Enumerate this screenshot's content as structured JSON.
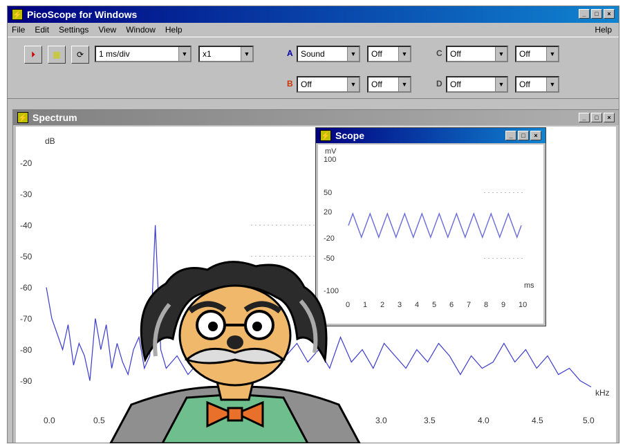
{
  "app": {
    "title": "PicoScope for Windows",
    "help_label": "Help",
    "menu": [
      "File",
      "Edit",
      "Settings",
      "View",
      "Window",
      "Help"
    ]
  },
  "toolbar": {
    "timebase": "1 ms/div",
    "multiplier": "x1",
    "channel_a_label": "A",
    "channel_a_coupling": "Sound",
    "channel_a_range": "Off",
    "channel_b_label": "B",
    "channel_b_coupling": "Off",
    "channel_b_range": "Off",
    "channel_c_label": "C",
    "channel_c_coupling": "Off",
    "channel_c_range": "Off",
    "channel_d_label": "D",
    "channel_d_coupling": "Off",
    "channel_d_range": "Off"
  },
  "spectrum": {
    "title": "Spectrum",
    "y_unit": "dB",
    "x_unit": "kHz",
    "y_ticks": [
      "-20",
      "-30",
      "-40",
      "-50",
      "-60",
      "-70",
      "-80",
      "-90"
    ],
    "x_ticks": [
      "0.0",
      "0.5",
      "3.0",
      "3.5",
      "4.0",
      "4.5",
      "5.0"
    ]
  },
  "scope": {
    "title": "Scope",
    "y_unit": "mV",
    "x_unit": "ms",
    "y_ticks": [
      "100",
      "50",
      "20",
      "-20",
      "-50",
      "-100"
    ],
    "x_ticks": [
      "0",
      "1",
      "2",
      "3",
      "4",
      "5",
      "6",
      "7",
      "8",
      "9",
      "10"
    ]
  },
  "chart_data": [
    {
      "type": "line",
      "title": "",
      "xlabel": "kHz",
      "ylabel": "dB",
      "xlim": [
        0.0,
        5.0
      ],
      "ylim": [
        -95,
        -15
      ],
      "series": [
        {
          "x": [
            0.0,
            0.05,
            0.1,
            0.15,
            0.2,
            0.25,
            0.3,
            0.35,
            0.4,
            0.45,
            0.5,
            0.55,
            0.6,
            0.65,
            0.7,
            0.75,
            0.8,
            0.85,
            0.9,
            0.95,
            1.0,
            1.05,
            1.1,
            1.2,
            1.3,
            1.4,
            1.5,
            1.6,
            1.7,
            1.8,
            1.9,
            2.0,
            2.1,
            2.2,
            2.3,
            2.4,
            2.5,
            2.6,
            2.7,
            2.8,
            2.9,
            3.0,
            3.1,
            3.2,
            3.3,
            3.4,
            3.5,
            3.6,
            3.7,
            3.8,
            3.9,
            4.0,
            4.1,
            4.2,
            4.3,
            4.4,
            4.5,
            4.6,
            4.7,
            4.8,
            4.9,
            5.0
          ],
          "values": [
            -60,
            -70,
            -75,
            -80,
            -72,
            -85,
            -78,
            -82,
            -90,
            -70,
            -80,
            -72,
            -86,
            -78,
            -84,
            -88,
            -80,
            -76,
            -86,
            -82,
            -40,
            -80,
            -86,
            -82,
            -88,
            -84,
            -80,
            -86,
            -82,
            -88,
            -84,
            -80,
            -86,
            -82,
            -78,
            -84,
            -80,
            -86,
            -76,
            -84,
            -80,
            -86,
            -78,
            -82,
            -86,
            -80,
            -84,
            -78,
            -82,
            -88,
            -82,
            -86,
            -84,
            -78,
            -84,
            -80,
            -86,
            -82,
            -88,
            -86,
            -90,
            -92
          ]
        }
      ]
    },
    {
      "type": "line",
      "title": "",
      "xlabel": "ms",
      "ylabel": "mV",
      "xlim": [
        0,
        10
      ],
      "ylim": [
        -100,
        100
      ],
      "series": [
        {
          "x": [
            0,
            0.25,
            0.5,
            0.75,
            1,
            1.25,
            1.5,
            1.75,
            2,
            2.25,
            2.5,
            2.75,
            3,
            3.25,
            3.5,
            3.75,
            4,
            4.25,
            4.5,
            4.75,
            5,
            5.25,
            5.5,
            5.75,
            6,
            6.25,
            6.5,
            6.75,
            7,
            7.25,
            7.5,
            7.75,
            8,
            8.25,
            8.5,
            8.75,
            9,
            9.25,
            9.5,
            9.75,
            10
          ],
          "values": [
            0,
            18,
            0,
            -18,
            0,
            18,
            0,
            -18,
            0,
            18,
            0,
            -18,
            0,
            18,
            0,
            -18,
            0,
            18,
            0,
            -18,
            0,
            18,
            0,
            -18,
            0,
            18,
            0,
            -18,
            0,
            18,
            0,
            -18,
            0,
            18,
            0,
            -18,
            0,
            18,
            0,
            -18,
            0
          ]
        }
      ]
    }
  ]
}
